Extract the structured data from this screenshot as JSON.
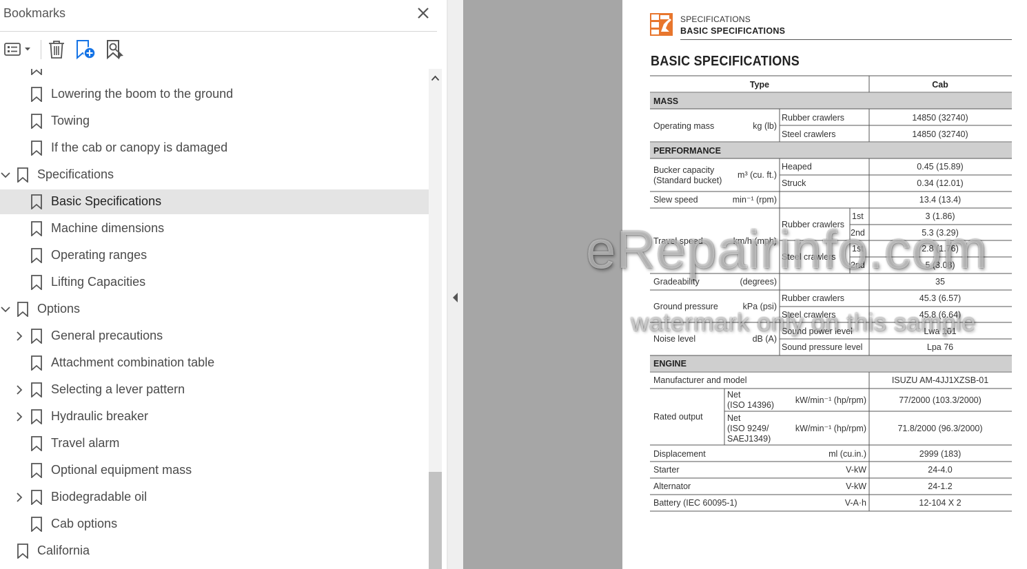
{
  "bookmarks_panel": {
    "title": "Bookmarks",
    "toolbar": {
      "options_icon": "list-options-icon",
      "delete_icon": "trash-icon",
      "add_icon": "add-bookmark-icon",
      "find_icon": "find-bookmark-icon"
    },
    "items": [
      {
        "label": "Lowering the boom to the ground",
        "level": 2,
        "expander": "none",
        "selected": false
      },
      {
        "label": "Towing",
        "level": 2,
        "expander": "none",
        "selected": false
      },
      {
        "label": "If the cab or canopy is damaged",
        "level": 2,
        "expander": "none",
        "selected": false
      },
      {
        "label": "Specifications",
        "level": 1,
        "expander": "expanded",
        "selected": false
      },
      {
        "label": "Basic Specifications",
        "level": 2,
        "expander": "none",
        "selected": true
      },
      {
        "label": "Machine dimensions",
        "level": 2,
        "expander": "none",
        "selected": false
      },
      {
        "label": "Operating ranges",
        "level": 2,
        "expander": "none",
        "selected": false
      },
      {
        "label": "Lifting Capacities",
        "level": 2,
        "expander": "none",
        "selected": false
      },
      {
        "label": "Options",
        "level": 1,
        "expander": "expanded",
        "selected": false
      },
      {
        "label": "General precautions",
        "level": 2,
        "expander": "collapsed",
        "selected": false
      },
      {
        "label": "Attachment combination table",
        "level": 2,
        "expander": "none",
        "selected": false
      },
      {
        "label": "Selecting a lever pattern",
        "level": 2,
        "expander": "collapsed",
        "selected": false
      },
      {
        "label": "Hydraulic breaker",
        "level": 2,
        "expander": "collapsed",
        "selected": false
      },
      {
        "label": "Travel alarm",
        "level": 2,
        "expander": "none",
        "selected": false
      },
      {
        "label": "Optional equipment mass",
        "level": 2,
        "expander": "none",
        "selected": false
      },
      {
        "label": "Biodegradable oil",
        "level": 2,
        "expander": "collapsed",
        "selected": false
      },
      {
        "label": "Cab options",
        "level": 2,
        "expander": "none",
        "selected": false
      },
      {
        "label": "California",
        "level": 1,
        "expander": "none",
        "selected": false
      }
    ]
  },
  "document": {
    "header_section": "SPECIFICATIONS",
    "header_subsection": "BASIC SPECIFICATIONS",
    "page_title": "BASIC SPECIFICATIONS",
    "spec_table": {
      "col_type": "Type",
      "col_cab": "Cab",
      "mass": {
        "heading": "MASS",
        "operating_mass": "Operating mass",
        "unit": "kg (lb)",
        "rubber": "Rubber crawlers",
        "rubber_val": "14850 (32740)",
        "steel": "Steel crawlers",
        "steel_val": "14850 (32740)"
      },
      "performance": {
        "heading": "PERFORMANCE",
        "bucket_1": "Bucker capacity",
        "bucket_2": "(Standard bucket)",
        "bucket_unit": "m³ (cu. ft.)",
        "heaped": "Heaped",
        "heaped_val": "0.45 (15.89)",
        "struck": "Struck",
        "struck_val": "0.34 (12.01)",
        "slew": "Slew speed",
        "slew_unit": "min⁻¹ (rpm)",
        "slew_val": "13.4 (13.4)",
        "travel": "Travel speed",
        "travel_unit": "km/h (mph)",
        "rubber": "Rubber crawlers",
        "steel": "Steel crawlers",
        "first": "1st",
        "second": "2nd",
        "travel_rubber_1st": "3 (1.86)",
        "travel_rubber_2nd": "5.3 (3.29)",
        "travel_steel_1st": "2.8 (1.76)",
        "travel_steel_2nd": "5 (3.08)",
        "grade": "Gradeability",
        "grade_unit": "(degrees)",
        "grade_val": "35",
        "ground": "Ground pressure",
        "ground_unit": "kPa (psi)",
        "ground_rubber": "Rubber crawlers",
        "ground_rubber_val": "45.3 (6.57)",
        "ground_steel": "Steel crawlers",
        "ground_steel_val": "45.8 (6.64)",
        "noise": "Noise level",
        "noise_unit": "dB (A)",
        "sound_power": "Sound power level",
        "sound_power_val": "Lwa 101",
        "sound_pressure": "Sound pressure level",
        "sound_pressure_val": "Lpa 76"
      },
      "engine": {
        "heading": "ENGINE",
        "manufacturer": "Manufacturer and model",
        "manufacturer_val": "ISUZU AM-4JJ1XZSB-01",
        "rated": "Rated output",
        "net1_a": "Net",
        "net1_b": "(ISO 14396)",
        "net1_unit": "kW/min⁻¹ (hp/rpm)",
        "net1_val": "77/2000 (103.3/2000)",
        "net2_a": "Net",
        "net2_b": "(ISO 9249/",
        "net2_c": "SAEJ1349)",
        "net2_unit": "kW/min⁻¹ (hp/rpm)",
        "net2_val": "71.8/2000 (96.3/2000)",
        "disp": "Displacement",
        "disp_unit": "ml (cu.in.)",
        "disp_val": "2999 (183)",
        "starter": "Starter",
        "starter_unit": "V-kW",
        "starter_val": "24-4.0",
        "alternator": "Alternator",
        "alternator_unit": "V-kW",
        "alternator_val": "24-1.2",
        "battery": "Battery (IEC 60095-1)",
        "battery_unit": "V-A·h",
        "battery_val": "12-104 X 2"
      }
    }
  },
  "watermark": {
    "main": "eRepairinfo.com",
    "sub": "watermark only on this sample"
  }
}
